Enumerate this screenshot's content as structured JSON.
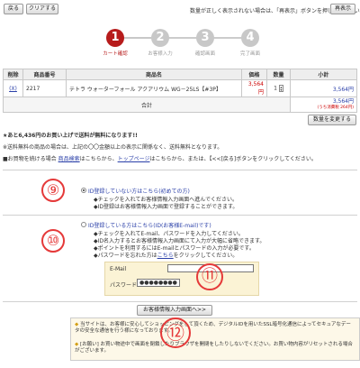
{
  "top": {
    "back_label": "戻る",
    "clear_label": "クリアする",
    "notice": "数量が正しく表示されない場合は、「再表示」ボタンを押してください。",
    "reload_label": "再表示"
  },
  "steps": [
    {
      "num": "1",
      "label": "カート確認",
      "active": true
    },
    {
      "num": "2",
      "label": "お客様入力",
      "active": false
    },
    {
      "num": "3",
      "label": "確認画面",
      "active": false
    },
    {
      "num": "4",
      "label": "完了画面",
      "active": false
    }
  ],
  "cart": {
    "headers": [
      "削除",
      "商品番号",
      "商品名",
      "価格",
      "数量",
      "小計"
    ],
    "row": {
      "delete": "(X)",
      "code": "2217",
      "name": "テトラ ウォーターフォール アクアリウム WG－25LS【#3P】",
      "price": "3,564円",
      "qty": "1",
      "subtotal": "3,564円"
    },
    "total_label": "合計",
    "total_value": "3,564円",
    "total_note": "(うち消費税 264円)",
    "change_qty_label": "数量を変更する"
  },
  "info": {
    "line1": "★あと6,436円のお買い上げで送料が無料になります!!",
    "line2": "※送料無料の商品の場合は、上記の〇〇金額以上の表示に関係なく、送料無料となります。",
    "line3_prefix": "■お買物を続ける場合",
    "line3_link1": "商品検索",
    "line3_mid": "はこちらから、",
    "line3_link2": "トップページ",
    "line3_suffix": "はこちらから、または、【<<[戻る]ボタンをクリックしてください。"
  },
  "login": {
    "option1_title": "ID登録していない方はこちら(初めての方)",
    "option1_note1": "◆チェックを入れてお客様情報入力画面へ進んでください。",
    "option1_note2": "◆ID登録はお客様情報入力画面で登録することができます。",
    "option2_title": "ID登録している方はこちら(ID(お客様E-mail)です)",
    "option2_note1": "◆チェックを入れてE-mail、パスワードを入力してください。",
    "option2_note2": "◆ID名入力するとお客様情報入力画面にて入力が大幅に省略できます。",
    "option2_note3": "◆ポイントを利用するにはE-mailとパスワードの入力が必要です。",
    "option2_note4_prefix": "◆パスワードを忘れた方は",
    "option2_note4_link": "こちら",
    "option2_note4_suffix": "をクリックしてください。",
    "email_label": "E-Mail",
    "password_label": "パスワード",
    "password_value": "●●●●●●●●"
  },
  "submit_label": "お客様情報入力画面へ>>",
  "notes": {
    "note1": "当サイトは、お客様に安心してショッピングをして頂くため、デジタルIDを用いたSSL暗号化通信によってセキュアなデータの安全な通信を行う様になっております。",
    "note2": "[お願い] お買い物途中で画面を閉鎖したりブラウザを開閉をしたりしないでください。お買い物内容がリセットされる場合がございます。"
  },
  "annotations": [
    "⑨",
    "⑩",
    "⑪",
    "⑫"
  ],
  "colors": {
    "accent": "#b71c1c",
    "inactive": "#c8c8c8",
    "annotation": "#e53939",
    "link": "#2a3fa8"
  }
}
